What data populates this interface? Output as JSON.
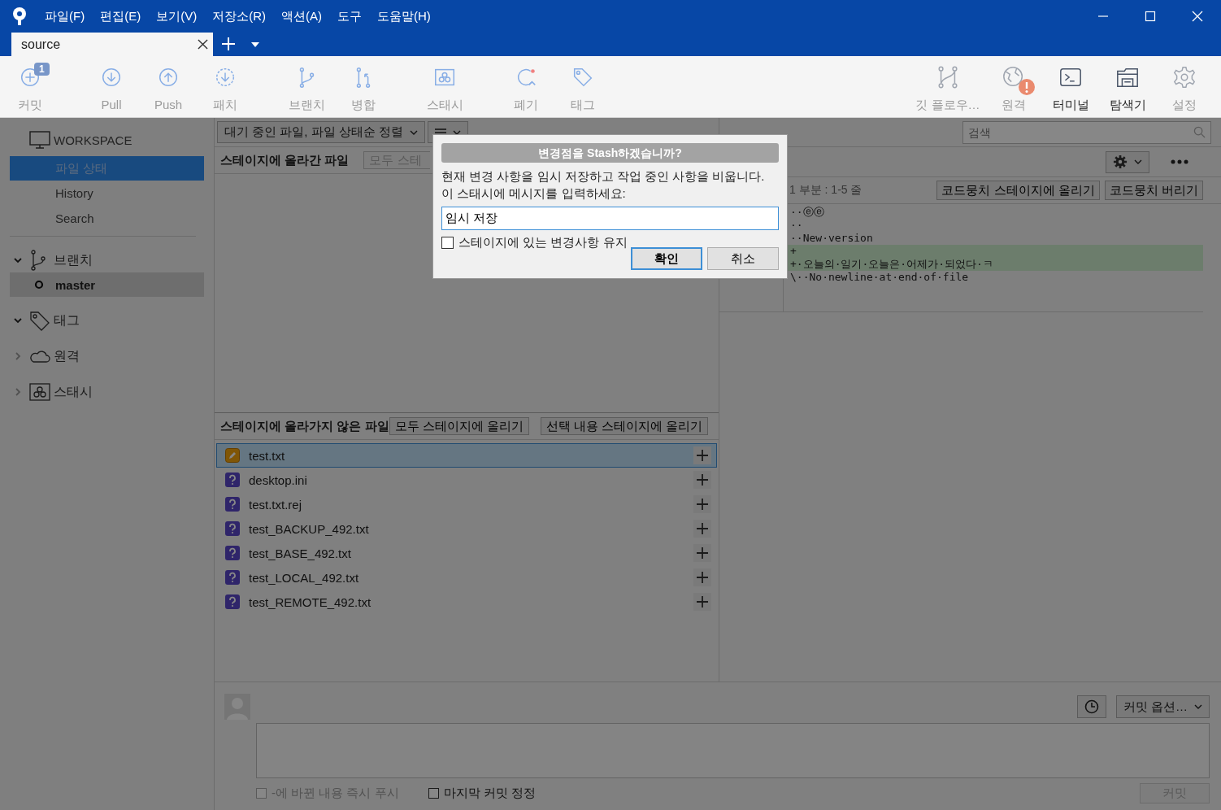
{
  "window": {
    "menu": [
      "파일(F)",
      "편집(E)",
      "보기(V)",
      "저장소(R)",
      "액션(A)",
      "도구",
      "도움말(H)"
    ]
  },
  "tabs": [
    {
      "label": "source",
      "selected": true
    }
  ],
  "toolbar": {
    "left": [
      {
        "kind": "commit",
        "label": "커밋",
        "disabled": true,
        "badge": "1"
      },
      {
        "kind": "pull",
        "label": "Pull",
        "disabled": true
      },
      {
        "kind": "push",
        "label": "Push",
        "disabled": true
      },
      {
        "kind": "patch",
        "label": "패치",
        "disabled": true
      },
      {
        "kind": "branch",
        "label": "브랜치",
        "disabled": true
      },
      {
        "kind": "merge",
        "label": "병합",
        "disabled": true
      },
      {
        "kind": "stash",
        "label": "스태시",
        "disabled": true
      },
      {
        "kind": "discard",
        "label": "폐기",
        "disabled": true
      },
      {
        "kind": "tag",
        "label": "태그",
        "disabled": true
      }
    ],
    "right": [
      {
        "kind": "gitflow",
        "label": "깃 플로우…",
        "disabled": true,
        "alert": false
      },
      {
        "kind": "remote",
        "label": "원격",
        "disabled": true,
        "alert": true
      },
      {
        "kind": "terminal",
        "label": "터미널",
        "disabled": false,
        "alert": false
      },
      {
        "kind": "explorer",
        "label": "탐색기",
        "disabled": false,
        "alert": false
      },
      {
        "kind": "settings",
        "label": "설정",
        "disabled": true,
        "alert": false
      }
    ]
  },
  "sidebar": {
    "workspace": {
      "title": "WORKSPACE",
      "items": [
        {
          "label": "파일 상태",
          "selected": true
        },
        {
          "label": "History",
          "selected": false
        },
        {
          "label": "Search",
          "selected": false
        }
      ]
    },
    "sections": [
      {
        "kind": "branches",
        "label": "브랜치",
        "expanded": true,
        "children": [
          {
            "label": "master",
            "selected": true
          }
        ]
      },
      {
        "kind": "tags",
        "label": "태그",
        "expanded": true
      },
      {
        "kind": "remotes",
        "label": "원격",
        "expanded": false
      },
      {
        "kind": "stashes",
        "label": "스태시",
        "expanded": false
      }
    ]
  },
  "file_view": {
    "sort": "대기 중인 파일, 파일 상태순 정렬",
    "staged": {
      "title": "스테이지에 올라간 파일",
      "button": "모두 스테"
    },
    "unstaged": {
      "title": "스테이지에 올라가지 않은 파일",
      "buttons": [
        "모두 스테이지에 올리기",
        "선택 내용 스테이지에 올리기"
      ],
      "files": [
        {
          "name": "test.txt",
          "kind": "modified",
          "selected": true
        },
        {
          "name": "desktop.ini",
          "kind": "untracked",
          "selected": false
        },
        {
          "name": "test.txt.rej",
          "kind": "untracked",
          "selected": false
        },
        {
          "name": "test_BACKUP_492.txt",
          "kind": "untracked",
          "selected": false
        },
        {
          "name": "test_BASE_492.txt",
          "kind": "untracked",
          "selected": false
        },
        {
          "name": "test_LOCAL_492.txt",
          "kind": "untracked",
          "selected": false
        },
        {
          "name": "test_REMOTE_492.txt",
          "kind": "untracked",
          "selected": false
        }
      ]
    }
  },
  "diff": {
    "search": {
      "placeholder": "검색"
    },
    "hunk": {
      "header": "1 부분 : 1-5 줄",
      "buttons": [
        "코드뭉치 스테이지에 올리기",
        "코드뭉치 버리기"
      ]
    },
    "lines": [
      {
        "text": "··ⓔⓔ",
        "kind": "context"
      },
      {
        "text": "··",
        "kind": "context"
      },
      {
        "text": "··New·version",
        "kind": "context"
      },
      {
        "text": "+",
        "kind": "added"
      },
      {
        "text": "+·오늘의·일기·오늘은·어제가·되었다·ㅋ",
        "kind": "added"
      },
      {
        "text": "\\··No·newline·at·end·of·file",
        "kind": "context"
      }
    ]
  },
  "commit": {
    "options": "커밋 옵션…",
    "push": {
      "label": "-에 바뀐 내용 즉시 푸시",
      "checked": false,
      "disabled": true
    },
    "amend": {
      "label": "마지막 커밋 정정",
      "checked": false,
      "disabled": false
    },
    "button": {
      "label": "커밋",
      "disabled": true
    }
  },
  "dialog": {
    "title": "변경점을 Stash하겠습니까?",
    "message": [
      "현재 변경 사항을 임시 저장하고 작업 중인 사항을 비웁니다.",
      "이 스태시에 메시지를 입력하세요:"
    ],
    "input": "임시 저장",
    "keep": {
      "label": "스테이지에 있는 변경사항 유지",
      "checked": false
    },
    "buttons": [
      {
        "label": "확인",
        "default": true
      },
      {
        "label": "취소",
        "default": false
      }
    ]
  }
}
